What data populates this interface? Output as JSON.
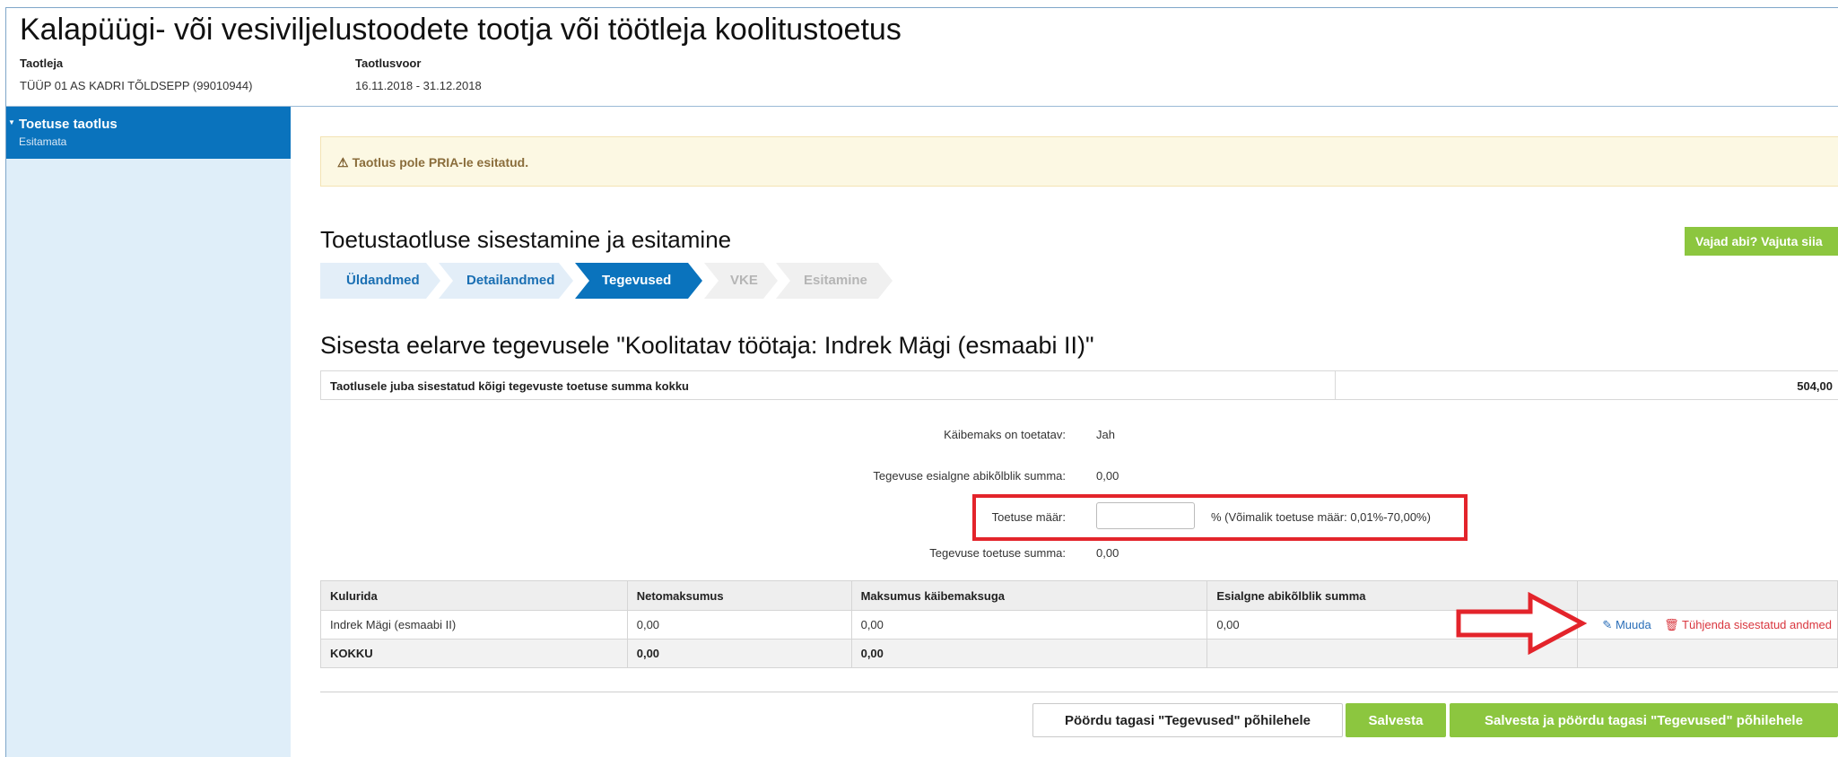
{
  "page": {
    "title": "Kalapüügi- või vesiviljelustoodete tootja või töötleja koolitustoetus",
    "applicant_label": "Taotleja",
    "applicant_value": "TÜÜP 01 AS KADRI TÕLDSEPP (99010944)",
    "round_label": "Taotlusvoor",
    "round_value": "16.11.2018 - 31.12.2018"
  },
  "sidebar": {
    "items": [
      {
        "label": "Toetuse taotlus",
        "status": "Esitamata"
      }
    ]
  },
  "alert": {
    "text": "Taotlus pole PRIA-le esitatud."
  },
  "section": {
    "title": "Toetustaotluse sisestamine ja esitamine",
    "help_button": "Vajad abi? Vajuta siia"
  },
  "steps": [
    {
      "label": "Üldandmed",
      "state": "done"
    },
    {
      "label": "Detailandmed",
      "state": "done"
    },
    {
      "label": "Tegevused",
      "state": "active"
    },
    {
      "label": "VKE",
      "state": "disabled"
    },
    {
      "label": "Esitamine",
      "state": "disabled"
    }
  ],
  "budget": {
    "title": "Sisesta eelarve tegevusele \"Koolitatav töötaja: Indrek Mägi (esmaabi II)\"",
    "total_label": "Taotlusele juba sisestatud kõigi tegevuste toetuse summa kokku",
    "total_value": "504,00",
    "vat_label": "Käibemaks on toetatav:",
    "vat_value": "Jah",
    "eligible_label": "Tegevuse esialgne abikõlblik summa:",
    "eligible_value": "0,00",
    "rate_label": "Toetuse määr:",
    "rate_value": "",
    "rate_hint": "% (Võimalik toetuse määr: 0,01%-70,00%)",
    "support_label": "Tegevuse toetuse summa:",
    "support_value": "0,00"
  },
  "table": {
    "headers": [
      "Kulurida",
      "Netomaksumus",
      "Maksumus käibemaksuga",
      "Esialgne abikõlblik summa",
      ""
    ],
    "rows": [
      {
        "name": "Indrek Mägi (esmaabi II)",
        "net": "0,00",
        "gross": "0,00",
        "eligible": "0,00",
        "edit": "Muuda",
        "clear": "Tühjenda sisestatud andmed"
      }
    ],
    "sum": {
      "name": "KOKKU",
      "net": "0,00",
      "gross": "0,00"
    }
  },
  "footer": {
    "back_button": "Pöördu tagasi \"Tegevused\" põhilehele",
    "save_button": "Salvesta",
    "save_back_button": "Salvesta ja pöördu tagasi \"Tegevused\" põhilehele"
  },
  "colors": {
    "primary_blue": "#0a73bd",
    "step_done_bg": "#e3eef8",
    "green": "#8cc63f",
    "annotation_red": "#e3242b",
    "warning_bg": "#fcf8e3"
  }
}
